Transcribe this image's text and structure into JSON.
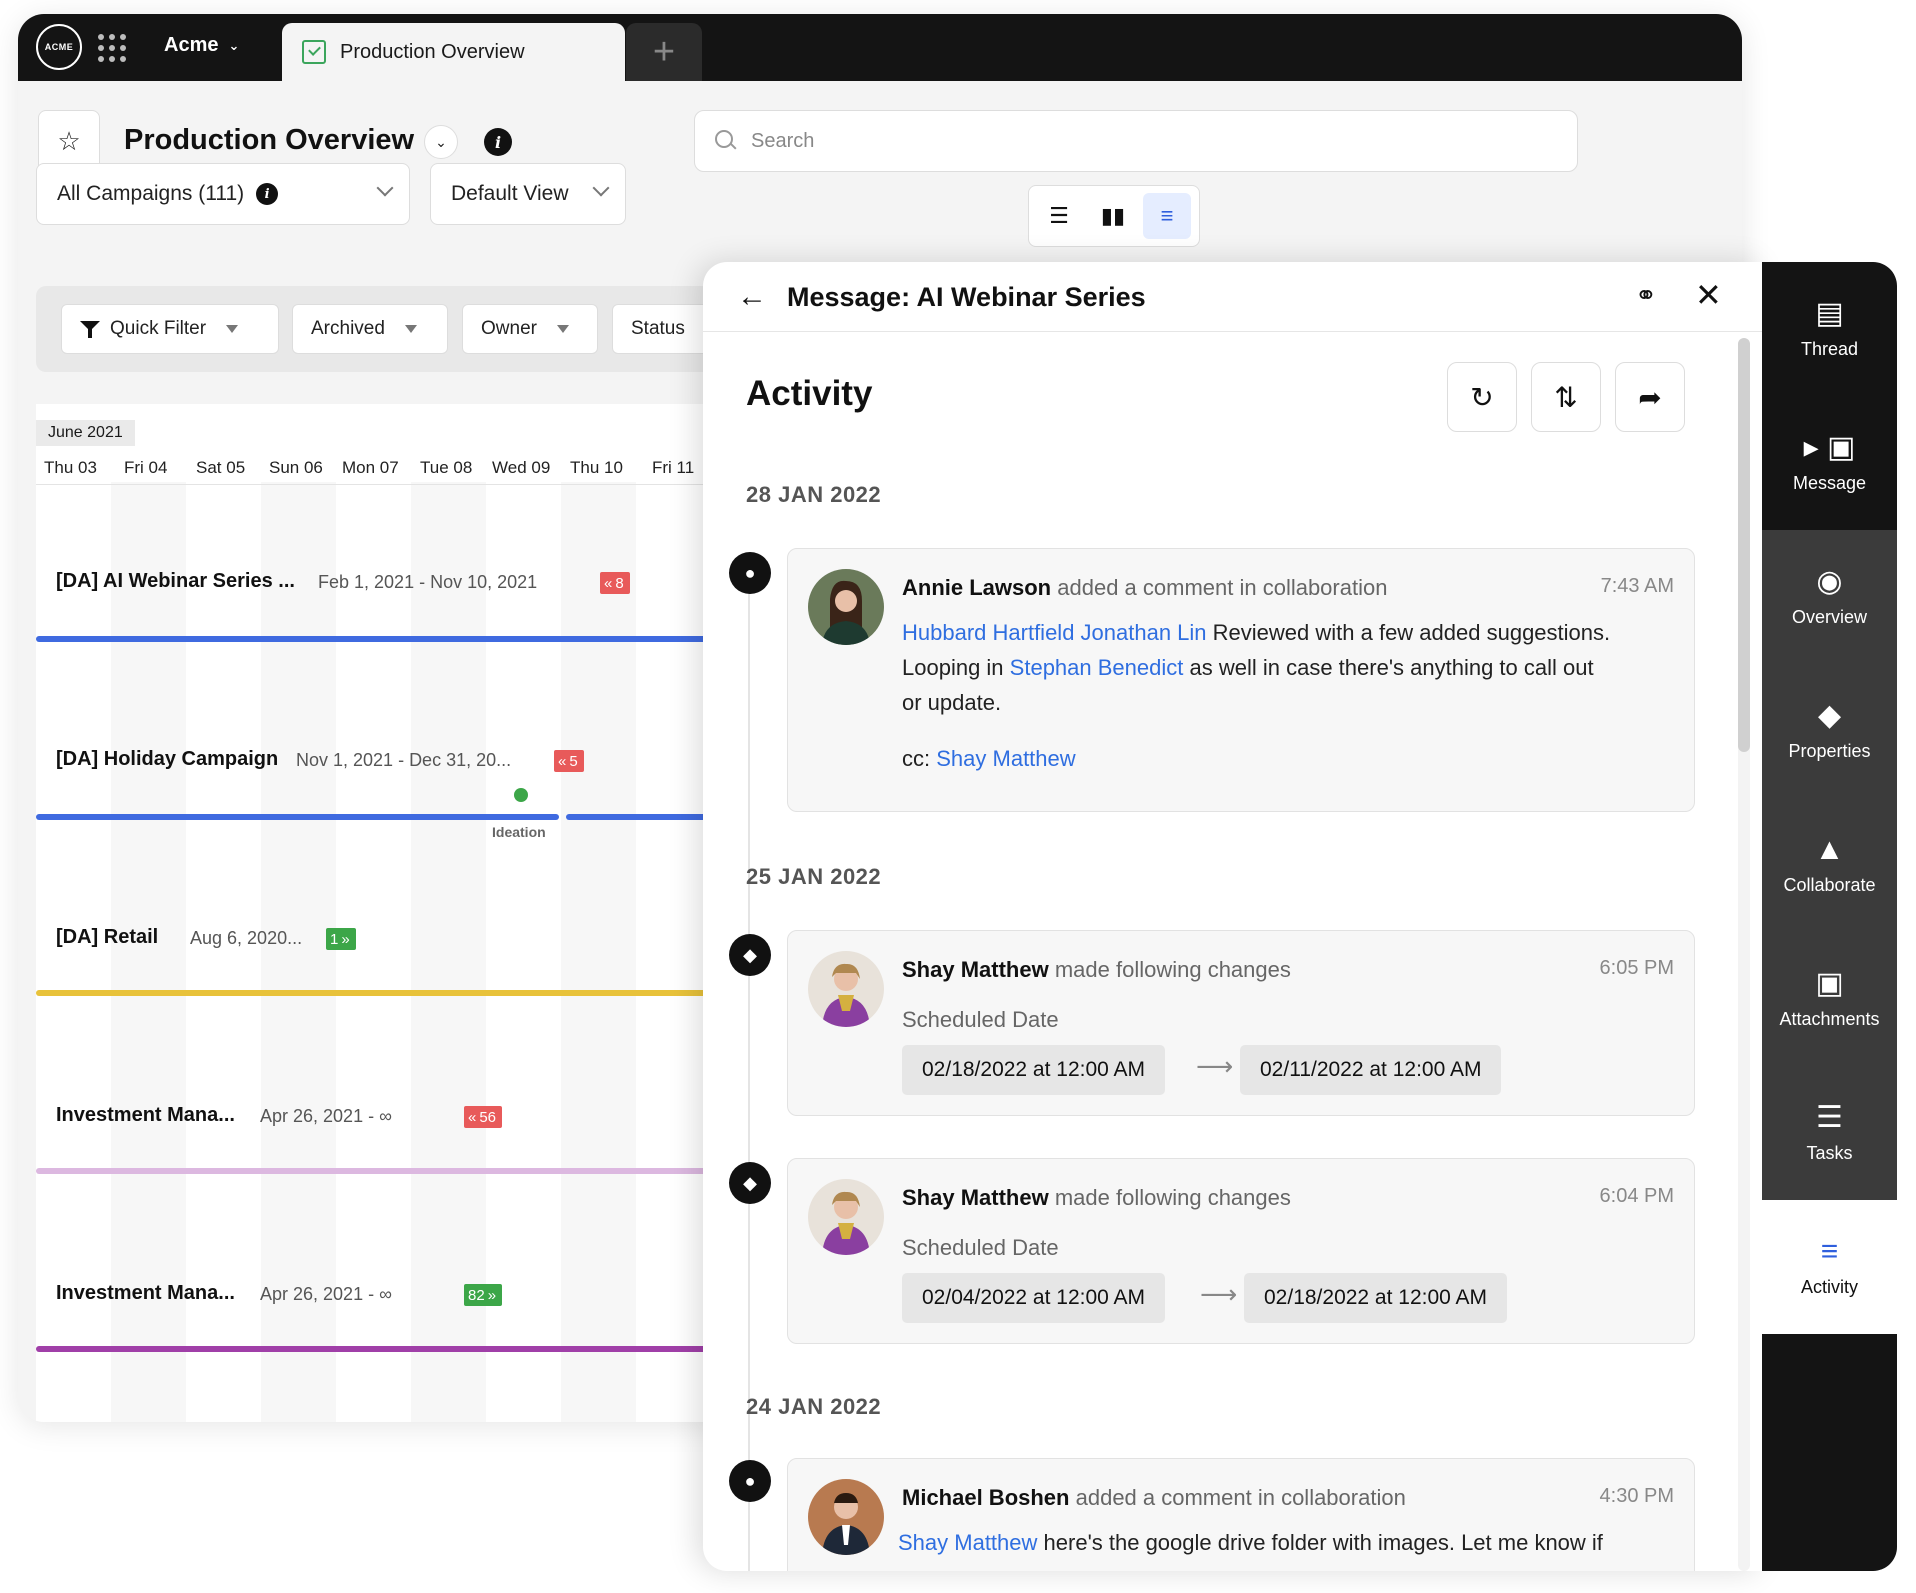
{
  "topbar": {
    "logo": "ACME",
    "org_name": "Acme",
    "active_tab": "Production Overview",
    "add_tab": "+"
  },
  "header": {
    "title": "Production Overview",
    "search_placeholder": "Search"
  },
  "selectors": {
    "campaigns": "All Campaigns (111)",
    "view": "Default View"
  },
  "filters": {
    "quick_filter": "Quick Filter",
    "archived": "Archived",
    "owner": "Owner",
    "status": "Status"
  },
  "calendar": {
    "month": "June 2021",
    "days": [
      "Thu 03",
      "Fri 04",
      "Sat 05",
      "Sun 06",
      "Mon 07",
      "Tue 08",
      "Wed 09",
      "Thu 10",
      "Fri 11"
    ],
    "rows": [
      {
        "title": "[DA] AI Webinar Series ...",
        "dates": "Feb 1, 2021 - Nov 10, 2021",
        "badge": "8",
        "badge_dir": "back",
        "badge_color": "#e85a5a",
        "bar_color": "#3f6ae0"
      },
      {
        "title": "[DA] Holiday Campaign",
        "dates": "Nov 1, 2021 - Dec 31, 20...",
        "badge": "5",
        "badge_dir": "back",
        "badge_color": "#e85a5a",
        "bar_color": "#3f6ae0",
        "milestone": "Ideation"
      },
      {
        "title": "[DA] Retail",
        "dates": "Aug 6, 2020...",
        "badge": "1",
        "badge_dir": "forward",
        "badge_color": "#3ca648",
        "bar_color": "#e8c23a"
      },
      {
        "title": "Investment Mana...",
        "dates": "Apr 26, 2021 - ∞",
        "badge": "56",
        "badge_dir": "back",
        "badge_color": "#e85a5a",
        "bar_color": "#dcb8e0"
      },
      {
        "title": "Investment Mana...",
        "dates": "Apr 26, 2021 - ∞",
        "badge": "82",
        "badge_dir": "forward",
        "badge_color": "#3ca648",
        "bar_color": "#a03fa8"
      }
    ]
  },
  "panel": {
    "title": "Message:  AI Webinar Series",
    "section": "Activity",
    "groups": [
      {
        "date": "28 JAN 2022"
      },
      {
        "date": "25 JAN 2022"
      },
      {
        "date": "24 JAN 2022"
      }
    ],
    "entries": [
      {
        "user": "Annie Lawson",
        "action": "added a comment in collaboration",
        "time": "7:43 AM",
        "mention1": "Hubbard Hartfield Jonathan Lin",
        "text1": "Reviewed with a few added suggestions.",
        "text2_pre": "Looping in",
        "mention2": "Stephan Benedict",
        "text2_post": "as well in case there's anything to call out",
        "text3": "or update.",
        "cc_label": "cc:",
        "cc_user": "Shay Matthew"
      },
      {
        "user": "Shay Matthew",
        "action": "made following changes",
        "time": "6:05 PM",
        "field": "Scheduled Date",
        "from": "02/18/2022 at 12:00 AM",
        "to": "02/11/2022 at 12:00 AM"
      },
      {
        "user": "Shay Matthew",
        "action": "made following changes",
        "time": "6:04 PM",
        "field": "Scheduled Date",
        "from": "02/04/2022 at 12:00 AM",
        "to": "02/18/2022 at 12:00 AM"
      },
      {
        "user": "Michael Boshen",
        "action": "added a comment in collaboration",
        "time": "4:30 PM",
        "mention1": "Shay Matthew",
        "text1": "here's the google drive folder with images. Let me know if"
      }
    ]
  },
  "rail": {
    "items": [
      {
        "label": "Thread",
        "icon": "thread-icon"
      },
      {
        "label": "Message",
        "icon": "message-icon"
      },
      {
        "label": "Overview",
        "icon": "eye-icon"
      },
      {
        "label": "Properties",
        "icon": "tag-icon"
      },
      {
        "label": "Collaborate",
        "icon": "collaborate-icon"
      },
      {
        "label": "Attachments",
        "icon": "attachments-icon"
      },
      {
        "label": "Tasks",
        "icon": "tasks-icon"
      },
      {
        "label": "Activity",
        "icon": "activity-icon"
      }
    ]
  },
  "colors": {
    "accent": "#2f6ee0",
    "dark": "#141414",
    "badge_red": "#e85a5a",
    "badge_green": "#3ca648"
  }
}
